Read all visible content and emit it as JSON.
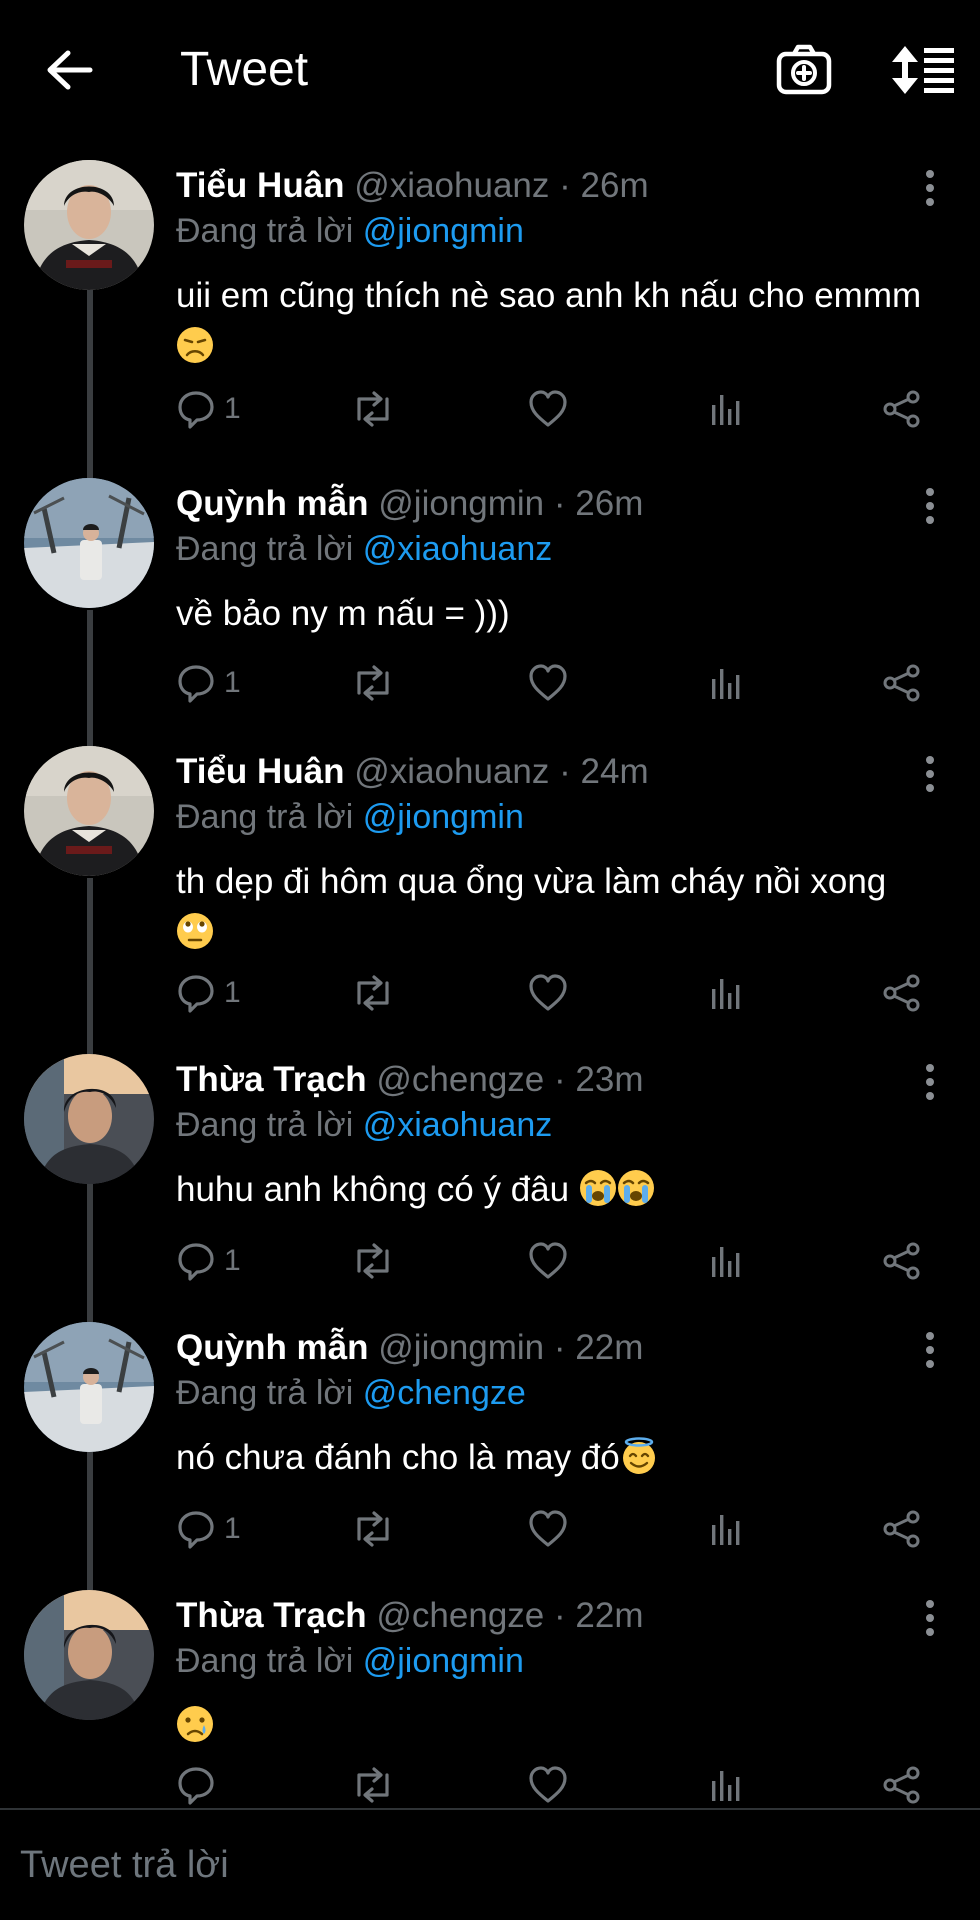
{
  "header": {
    "title": "Tweet",
    "back_icon": "arrow-left-icon",
    "camera_icon": "camera-plus-icon",
    "sort_icon": "sort-list-icon"
  },
  "colors": {
    "accent": "#1d9bf0",
    "muted": "#71767b",
    "background": "#000000"
  },
  "tweets": [
    {
      "name": "Tiểu Huân",
      "handle": "@xiaohuanz",
      "sep": "·",
      "time": "26m",
      "reply_label": "Đang trả lời",
      "reply_to": "@jiongmin",
      "text": "uii em cũng thích nè sao anh kh nấu cho emmm",
      "emoji": "disappointed",
      "reply_count": "1"
    },
    {
      "name": "Quỳnh mẫn",
      "handle": "@jiongmin",
      "sep": "·",
      "time": "26m",
      "reply_label": "Đang trả lời",
      "reply_to": "@xiaohuanz",
      "text": "về bảo ny m nấu = )))",
      "emoji": "",
      "reply_count": "1"
    },
    {
      "name": "Tiểu Huân",
      "handle": "@xiaohuanz",
      "sep": "·",
      "time": "24m",
      "reply_label": "Đang trả lời",
      "reply_to": "@jiongmin",
      "text": "th dẹp đi hôm qua ổng vừa làm cháy nồi xong",
      "emoji": "eye-roll",
      "reply_count": "1"
    },
    {
      "name": "Thừa Trạch",
      "handle": "@chengze",
      "sep": "·",
      "time": "23m",
      "reply_label": "Đang trả lời",
      "reply_to": "@xiaohuanz",
      "text": "huhu anh không có ý đâu",
      "emoji": "sob-sob",
      "reply_count": "1"
    },
    {
      "name": "Quỳnh mẫn",
      "handle": "@jiongmin",
      "sep": "·",
      "time": "22m",
      "reply_label": "Đang trả lời",
      "reply_to": "@chengze",
      "text": "nó chưa đánh cho là may đó",
      "emoji": "halo",
      "reply_count": "1"
    },
    {
      "name": "Thừa Trạch",
      "handle": "@chengze",
      "sep": "·",
      "time": "22m",
      "reply_label": "Đang trả lời",
      "reply_to": "@jiongmin",
      "text": "",
      "emoji": "crying",
      "reply_count": ""
    }
  ],
  "composer": {
    "placeholder": "Tweet trả lời"
  }
}
